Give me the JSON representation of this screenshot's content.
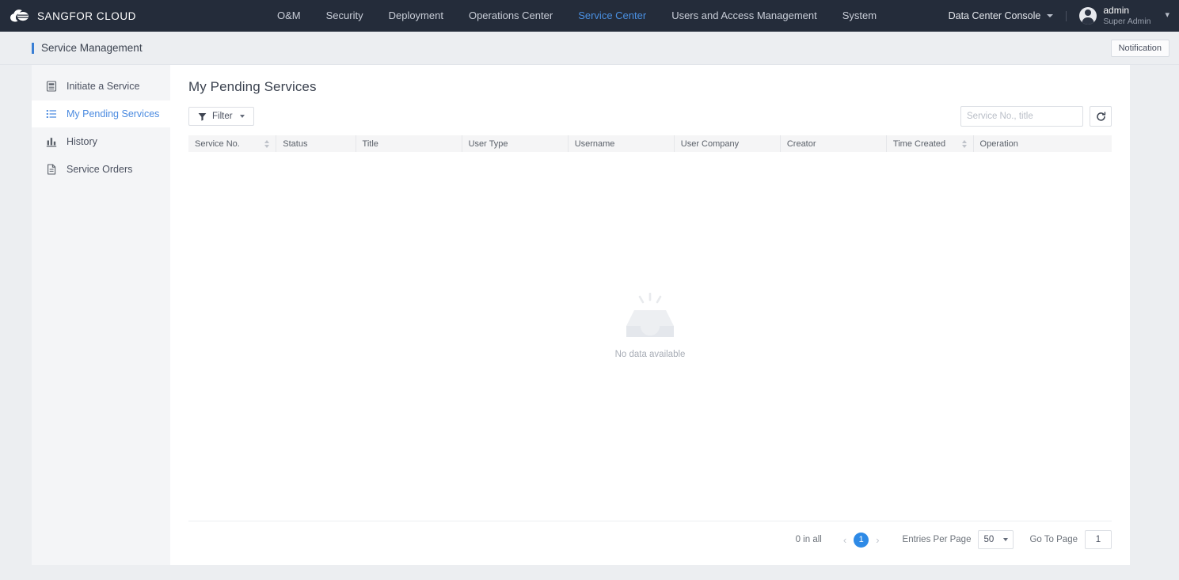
{
  "brand": {
    "name": "SANGFOR CLOUD",
    "logo_icon": "cloud-logo-icon"
  },
  "topnav": {
    "items": [
      {
        "label": "O&M",
        "active": false
      },
      {
        "label": "Security",
        "active": false
      },
      {
        "label": "Deployment",
        "active": false
      },
      {
        "label": "Operations Center",
        "active": false
      },
      {
        "label": "Service Center",
        "active": true
      },
      {
        "label": "Users and Access Management",
        "active": false
      },
      {
        "label": "System",
        "active": false
      }
    ],
    "console_selector": "Data Center Console",
    "user": {
      "name": "admin",
      "role": "Super Admin"
    }
  },
  "subheader": {
    "breadcrumb": "Service Management",
    "notification_label": "Notification"
  },
  "sidebar": {
    "items": [
      {
        "label": "Initiate a Service",
        "icon": "form-icon",
        "active": false
      },
      {
        "label": "My Pending Services",
        "icon": "list-icon",
        "active": true
      },
      {
        "label": "History",
        "icon": "bar-chart-icon",
        "active": false
      },
      {
        "label": "Service Orders",
        "icon": "document-icon",
        "active": false
      }
    ]
  },
  "main": {
    "title": "My Pending Services",
    "filter_label": "Filter",
    "search": {
      "value": "",
      "placeholder": "Service No., title"
    },
    "refresh_icon": "refresh-icon",
    "columns": [
      {
        "label": "Service No.",
        "sortable": true
      },
      {
        "label": "Status",
        "sortable": false
      },
      {
        "label": "Title",
        "sortable": false
      },
      {
        "label": "User Type",
        "sortable": false
      },
      {
        "label": "Username",
        "sortable": false
      },
      {
        "label": "User Company",
        "sortable": false
      },
      {
        "label": "Creator",
        "sortable": false
      },
      {
        "label": "Time Created",
        "sortable": true
      },
      {
        "label": "Operation",
        "sortable": false
      }
    ],
    "rows": [],
    "empty_text": "No data available"
  },
  "pagination": {
    "total_text": "0 in all",
    "prev_icon": "chevron-left-icon",
    "next_icon": "chevron-right-icon",
    "current_page": "1",
    "entries_label": "Entries Per Page",
    "entries_value": "50",
    "goto_label": "Go To Page",
    "goto_value": "1"
  },
  "colors": {
    "header_bg": "#242c3a",
    "accent_blue": "#4a90e2",
    "page_bg": "#eceef1",
    "sidebar_bg": "#f4f5f7",
    "pager_active": "#2e8ae6"
  }
}
